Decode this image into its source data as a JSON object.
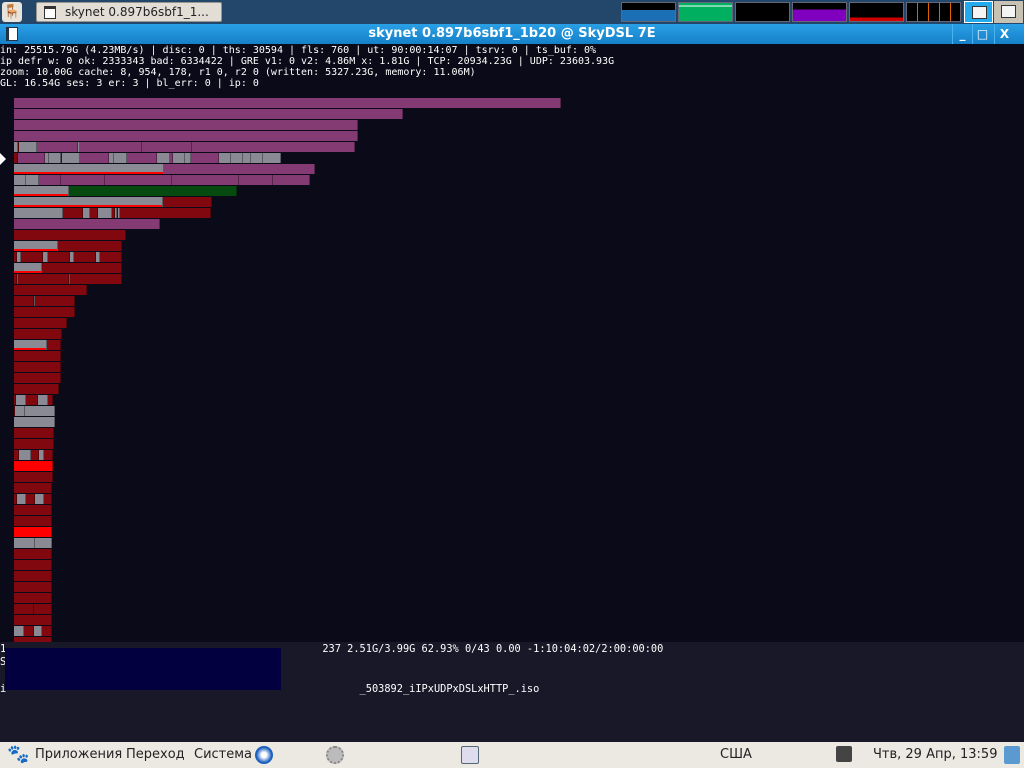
{
  "top_panel": {
    "task_button_label": "skynet 0.897b6sbf1_1...",
    "monitors": [
      {
        "name": "cpu",
        "color": "#1a6fb5"
      },
      {
        "name": "memory",
        "color": "#00b060"
      },
      {
        "name": "network",
        "color": "#000000"
      },
      {
        "name": "swap",
        "color": "#8000c0"
      },
      {
        "name": "load",
        "color": "#d00000"
      },
      {
        "name": "disk",
        "color": "#e06000"
      }
    ]
  },
  "window": {
    "title": "skynet 0.897b6sbf1_1b20 @ SkyDSL 7E",
    "minimize": "_",
    "maximize": "□",
    "close": "X"
  },
  "stats": [
    "in: 25515.79G (4.23MB/s) | disc: 0 | ths: 30594 | fls: 760 | ut: 90:00:14:07 | tsrv: 0 | ts_buf: 0%",
    "ip defr w: 0 ok: 2333343 bad: 6334422 | GRE v1: 0 v2: 4.86M x: 1.81G | TCP: 20934.23G | UDP: 23603.93G",
    "zoom: 10.00G cache: 8, 954, 178, r1 0, r2 0 (written: 5327.23G, memory: 11.06M)",
    "GL: 16.54G ses: 3 er: 3 | bl_err: 0 | ip: 0"
  ],
  "colors": {
    "p": "#843a72",
    "g": "#8a8a95",
    "r": "#820810",
    "R": "#ff0000",
    "G": "#064a10"
  },
  "bars": [
    [
      [
        "p",
        547
      ]
    ],
    [
      [
        "p",
        389
      ]
    ],
    [
      [
        "p",
        344
      ]
    ],
    [
      [
        "p",
        344
      ]
    ],
    [
      [
        "g",
        4
      ],
      [
        "r",
        1
      ],
      [
        "g",
        18
      ],
      [
        "p",
        41
      ],
      [
        "g",
        2
      ],
      [
        "p",
        62
      ],
      [
        "p",
        50
      ],
      [
        "p",
        163
      ]
    ],
    [
      [
        "r",
        4
      ],
      [
        "p",
        27
      ],
      [
        "g",
        4
      ],
      [
        "g",
        12
      ],
      [
        "r",
        1
      ],
      [
        "g",
        18
      ],
      [
        "p",
        29
      ],
      [
        "g",
        5
      ],
      [
        "g",
        13
      ],
      [
        "p",
        30
      ],
      [
        "g",
        13
      ],
      [
        "p",
        3
      ],
      [
        "g",
        12
      ],
      [
        "g",
        6
      ],
      [
        "p",
        28
      ],
      [
        "g",
        12
      ],
      [
        "g",
        12
      ],
      [
        "g",
        8
      ],
      [
        "g",
        12
      ],
      [
        "g",
        18
      ]
    ],
    [
      [
        "g",
        150,
        1
      ],
      [
        "p",
        151
      ]
    ],
    [
      [
        "g",
        12
      ],
      [
        "g",
        13
      ],
      [
        "p",
        22
      ],
      [
        "p",
        44
      ],
      [
        "p",
        67
      ],
      [
        "p",
        67
      ],
      [
        "p",
        34
      ],
      [
        "p",
        37
      ]
    ],
    [
      [
        "g",
        55,
        1
      ],
      [
        "G",
        168
      ]
    ],
    [
      [
        "g",
        149,
        1
      ],
      [
        "r",
        49
      ]
    ],
    [
      [
        "g",
        49
      ],
      [
        "r",
        20
      ],
      [
        "g",
        7
      ],
      [
        "r",
        8
      ],
      [
        "g",
        14
      ],
      [
        "r",
        3
      ],
      [
        "g",
        2
      ],
      [
        "r",
        1
      ],
      [
        "g",
        2
      ],
      [
        "r",
        91
      ]
    ],
    [
      [
        "p",
        146
      ]
    ],
    [
      [
        "r",
        112
      ]
    ],
    [
      [
        "g",
        44,
        1
      ],
      [
        "r",
        64
      ]
    ],
    [
      [
        "r",
        3
      ],
      [
        "g",
        4
      ],
      [
        "r",
        22
      ],
      [
        "g",
        5
      ],
      [
        "r",
        22
      ],
      [
        "g",
        4
      ],
      [
        "r",
        22
      ],
      [
        "g",
        4
      ],
      [
        "r",
        22
      ]
    ],
    [
      [
        "g",
        28,
        1
      ],
      [
        "r",
        80
      ]
    ],
    [
      [
        "r",
        3
      ],
      [
        "g",
        1
      ],
      [
        "r",
        51
      ],
      [
        "g",
        1
      ],
      [
        "r",
        52
      ]
    ],
    [
      [
        "r",
        73
      ]
    ],
    [
      [
        "r",
        20
      ],
      [
        "g",
        1
      ],
      [
        "r",
        40
      ]
    ],
    [
      [
        "r",
        61
      ]
    ],
    [
      [
        "r",
        53
      ]
    ],
    [
      [
        "r",
        48
      ]
    ],
    [
      [
        "g",
        33,
        1
      ],
      [
        "r",
        14
      ]
    ],
    [
      [
        "r",
        47
      ]
    ],
    [
      [
        "r",
        47
      ]
    ],
    [
      [
        "r",
        47
      ]
    ],
    [
      [
        "r",
        45
      ]
    ],
    [
      [
        "r",
        2
      ],
      [
        "g",
        10
      ],
      [
        "r",
        12
      ],
      [
        "g",
        10
      ],
      [
        "r",
        5
      ]
    ],
    [
      [
        "r",
        1
      ],
      [
        "g",
        10
      ],
      [
        "g",
        30
      ]
    ],
    [
      [
        "g",
        41
      ]
    ],
    [
      [
        "r",
        40
      ]
    ],
    [
      [
        "r",
        40
      ]
    ],
    [
      [
        "r",
        5
      ],
      [
        "g",
        12
      ],
      [
        "r",
        8
      ],
      [
        "g",
        5
      ],
      [
        "r",
        9
      ]
    ],
    [
      [
        "R",
        39
      ]
    ],
    [
      [
        "r",
        39
      ]
    ],
    [
      [
        "r",
        38
      ]
    ],
    [
      [
        "r",
        3
      ],
      [
        "g",
        9
      ],
      [
        "r",
        9
      ],
      [
        "g",
        9
      ],
      [
        "r",
        8
      ]
    ],
    [
      [
        "r",
        38
      ]
    ],
    [
      [
        "r",
        38
      ]
    ],
    [
      [
        "R",
        38
      ]
    ],
    [
      [
        "g",
        21
      ],
      [
        "g",
        17
      ]
    ],
    [
      [
        "r",
        38
      ]
    ],
    [
      [
        "r",
        38
      ]
    ],
    [
      [
        "r",
        38
      ]
    ],
    [
      [
        "r",
        38
      ]
    ],
    [
      [
        "r",
        38
      ]
    ],
    [
      [
        "r",
        20
      ],
      [
        "r",
        18
      ]
    ],
    [
      [
        "r",
        38
      ]
    ],
    [
      [
        "g",
        10
      ],
      [
        "r",
        10
      ],
      [
        "g",
        8
      ],
      [
        "r",
        10
      ]
    ],
    [
      [
        "r",
        38
      ]
    ]
  ],
  "bottom": {
    "line1": "1                                                   237 2.51G/3.99G 62.93% 0/43 0.00 -1:10:04:02/2:00:00:00",
    "line2": "S",
    "line3": "i                                                         _503892_iIPxUDPxDSLxHTTP_.iso"
  },
  "bottom_panel": {
    "applications": "Приложения",
    "places": "Переход",
    "system": "Система",
    "keyboard_layout": "США",
    "clock": "Чтв, 29 Апр, 13:59"
  }
}
